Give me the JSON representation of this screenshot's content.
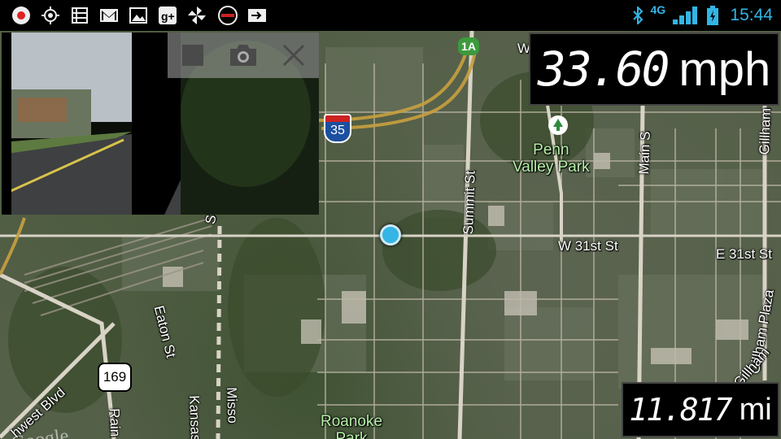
{
  "status_bar": {
    "left_icons": [
      "record-icon",
      "gps-target-icon",
      "list-icon",
      "gmail-icon",
      "gallery-icon",
      "google-plus-icon",
      "pinwheel-icon",
      "voicemail-icon",
      "forward-icon"
    ],
    "right_icons": [
      "bluetooth-icon",
      "lte-signal-icon",
      "battery-charging-icon"
    ],
    "network": "4G",
    "clock": "15:44",
    "accent": "#33b5e5"
  },
  "speed": {
    "value": "33.60",
    "unit": "mph"
  },
  "distance": {
    "value": "11.817",
    "unit": "mi"
  },
  "map": {
    "labels": {
      "summit": "Summit St",
      "penn_valley": "Penn\nValley Park",
      "w31": "W 31st St",
      "e31": "E 31st St",
      "eaton": "Eaton St",
      "main": "Main S",
      "gillham": "Gillham",
      "gillham_plaza": "Gillham Plaza",
      "gillham_rd": "Gillham",
      "roanoke": "Roanoke",
      "park": "Park",
      "northwest": "hwest Blvd",
      "kansas": "Kansas",
      "missouri": "Misso",
      "rain": "Rain",
      "s_partial": "S",
      "w_partial": "W"
    },
    "shields": {
      "i35": "35",
      "us169": "169",
      "exit1a": "1A"
    },
    "watermark": "Google"
  },
  "camera": {
    "buttons": [
      "stop-icon",
      "camera-icon",
      "close-icon"
    ]
  }
}
